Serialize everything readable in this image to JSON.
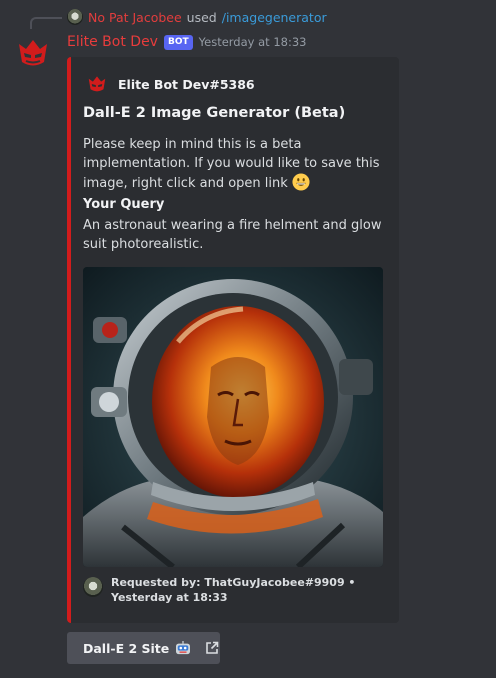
{
  "reply": {
    "user": "No Pat Jacobee",
    "used_text": "used",
    "command": "/imagegenerator"
  },
  "message": {
    "author": "Elite Bot Dev",
    "tag": "BOT",
    "timestamp": "Yesterday at 18:33"
  },
  "embed": {
    "accent_color": "#d21c1c",
    "author_name": "Elite Bot Dev#5386",
    "title": "Dall-E 2 Image Generator (Beta)",
    "description": "Please keep in mind this is a beta implementation. If you would like to save this image, right click and open link",
    "description_emoji": "grinning-face-emoji",
    "field_name": "Your Query",
    "field_value": "An astronaut wearing a fire helment and glow suit photorealistic.",
    "image_subject": "astronaut in helmet with orange fiery visor",
    "footer_text": "Requested by: ThatGuyJacobee#9909 • Yesterday at 18:33"
  },
  "button": {
    "label": "Dall-E 2 Site",
    "emoji": "robot-face-emoji",
    "icon": "external-link-icon"
  }
}
